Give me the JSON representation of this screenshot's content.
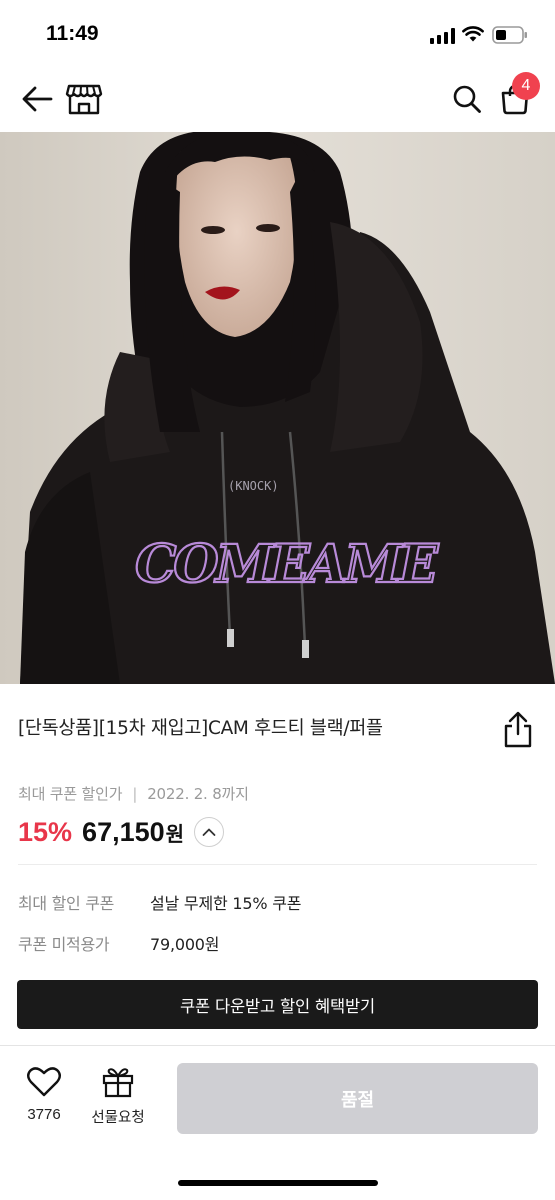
{
  "status_bar": {
    "time": "11:49"
  },
  "nav": {
    "cart_count": "4"
  },
  "product": {
    "title": "[단독상품][15차 재입고]CAM 후드티 블랙/퍼플",
    "image_text": "COMEAME",
    "coupon_price_label": "최대 쿠폰 할인가",
    "coupon_deadline": "2022. 2. 8까지",
    "discount_rate": "15%",
    "price": "67,150",
    "price_unit": "원"
  },
  "info": {
    "max_coupon_label": "최대 할인 쿠폰",
    "max_coupon_value": "설날 무제한 15% 쿠폰",
    "no_coupon_label": "쿠폰 미적용가",
    "no_coupon_value": "79,000원"
  },
  "coupon_button_label": "쿠폰 다운받고 할인 혜택받기",
  "bottom_bar": {
    "like_count": "3776",
    "gift_label": "선물요청",
    "soldout_label": "품절"
  },
  "colors": {
    "discount": "#e8364a",
    "badge": "#f0424f",
    "dark_button": "#1a1a1a",
    "disabled_button": "#cfcfd3"
  }
}
